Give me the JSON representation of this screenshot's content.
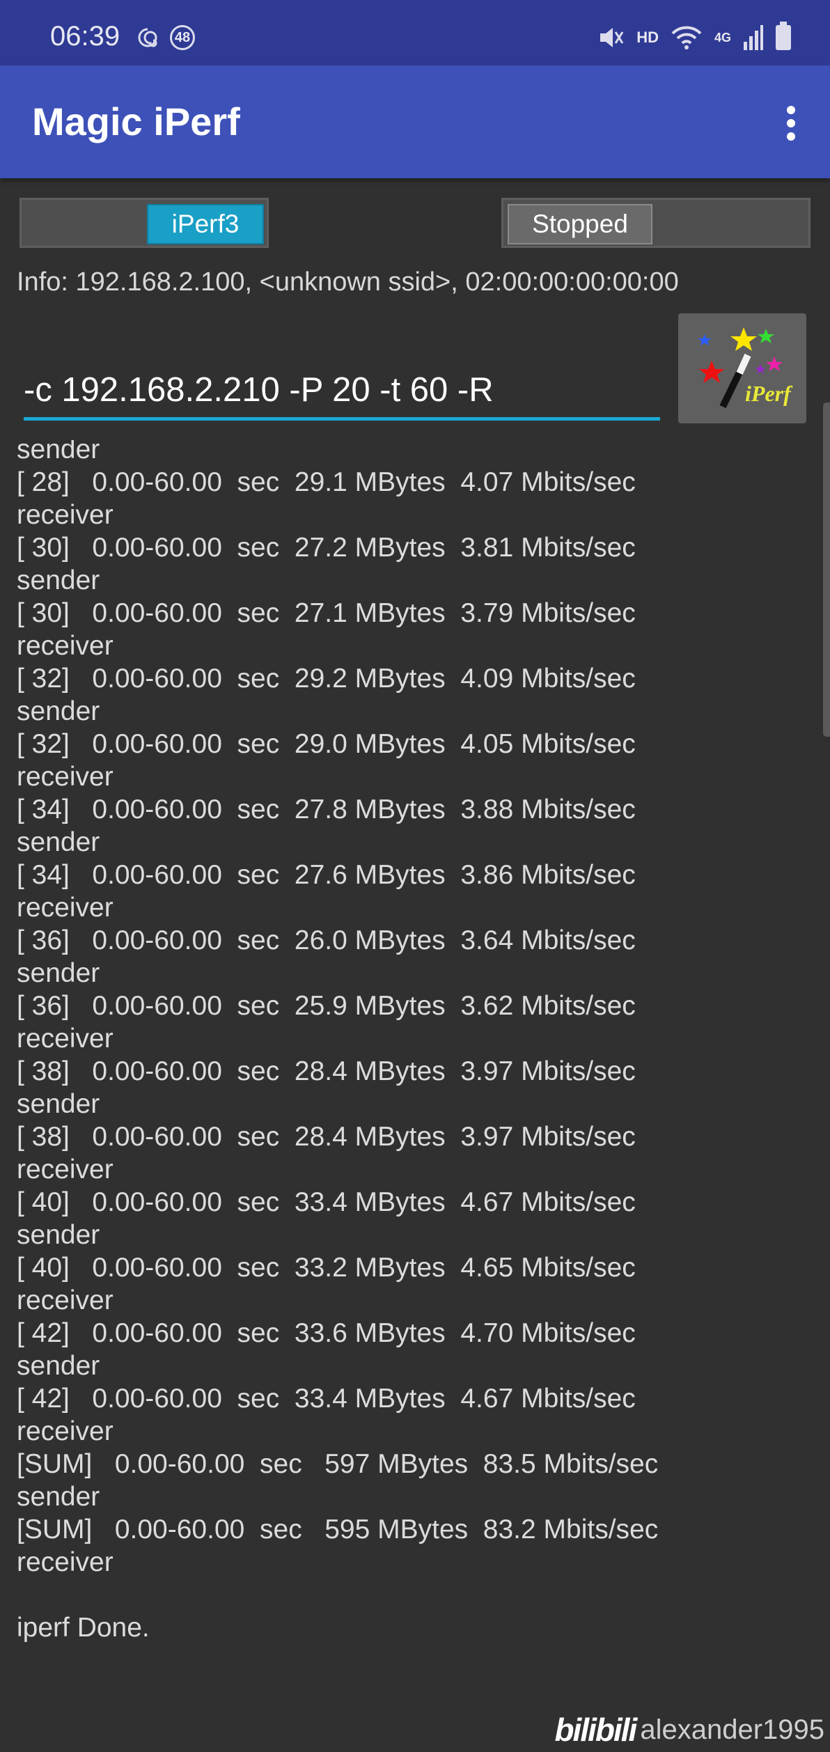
{
  "status_bar": {
    "time": "06:39",
    "badge_count": "48",
    "network_label": "HD",
    "network_type": "4G"
  },
  "app_bar": {
    "title": "Magic iPerf"
  },
  "controls": {
    "mode_button": "iPerf3",
    "state_button": "Stopped"
  },
  "info": "Info: 192.168.2.100, <unknown ssid>, 02:00:00:00:00:00",
  "command_input": "-c 192.168.2.210 -P 20 -t 60 -R",
  "logo_text": "iPerf",
  "log_lines": [
    "sender",
    "[ 28]   0.00-60.00  sec  29.1 MBytes  4.07 Mbits/sec",
    "receiver",
    "[ 30]   0.00-60.00  sec  27.2 MBytes  3.81 Mbits/sec",
    "sender",
    "[ 30]   0.00-60.00  sec  27.1 MBytes  3.79 Mbits/sec",
    "receiver",
    "[ 32]   0.00-60.00  sec  29.2 MBytes  4.09 Mbits/sec",
    "sender",
    "[ 32]   0.00-60.00  sec  29.0 MBytes  4.05 Mbits/sec",
    "receiver",
    "[ 34]   0.00-60.00  sec  27.8 MBytes  3.88 Mbits/sec",
    "sender",
    "[ 34]   0.00-60.00  sec  27.6 MBytes  3.86 Mbits/sec",
    "receiver",
    "[ 36]   0.00-60.00  sec  26.0 MBytes  3.64 Mbits/sec",
    "sender",
    "[ 36]   0.00-60.00  sec  25.9 MBytes  3.62 Mbits/sec",
    "receiver",
    "[ 38]   0.00-60.00  sec  28.4 MBytes  3.97 Mbits/sec",
    "sender",
    "[ 38]   0.00-60.00  sec  28.4 MBytes  3.97 Mbits/sec",
    "receiver",
    "[ 40]   0.00-60.00  sec  33.4 MBytes  4.67 Mbits/sec",
    "sender",
    "[ 40]   0.00-60.00  sec  33.2 MBytes  4.65 Mbits/sec",
    "receiver",
    "[ 42]   0.00-60.00  sec  33.6 MBytes  4.70 Mbits/sec",
    "sender",
    "[ 42]   0.00-60.00  sec  33.4 MBytes  4.67 Mbits/sec",
    "receiver",
    "[SUM]   0.00-60.00  sec   597 MBytes  83.5 Mbits/sec",
    "sender",
    "[SUM]   0.00-60.00  sec   595 MBytes  83.2 Mbits/sec",
    "receiver",
    "",
    "iperf Done."
  ],
  "watermark": {
    "logo": "bilibili",
    "user": "alexander1995"
  },
  "colors": {
    "status_bar": "#2f3a94",
    "app_bar": "#3d51b8",
    "background": "#303030",
    "accent": "#1a9fc6"
  }
}
